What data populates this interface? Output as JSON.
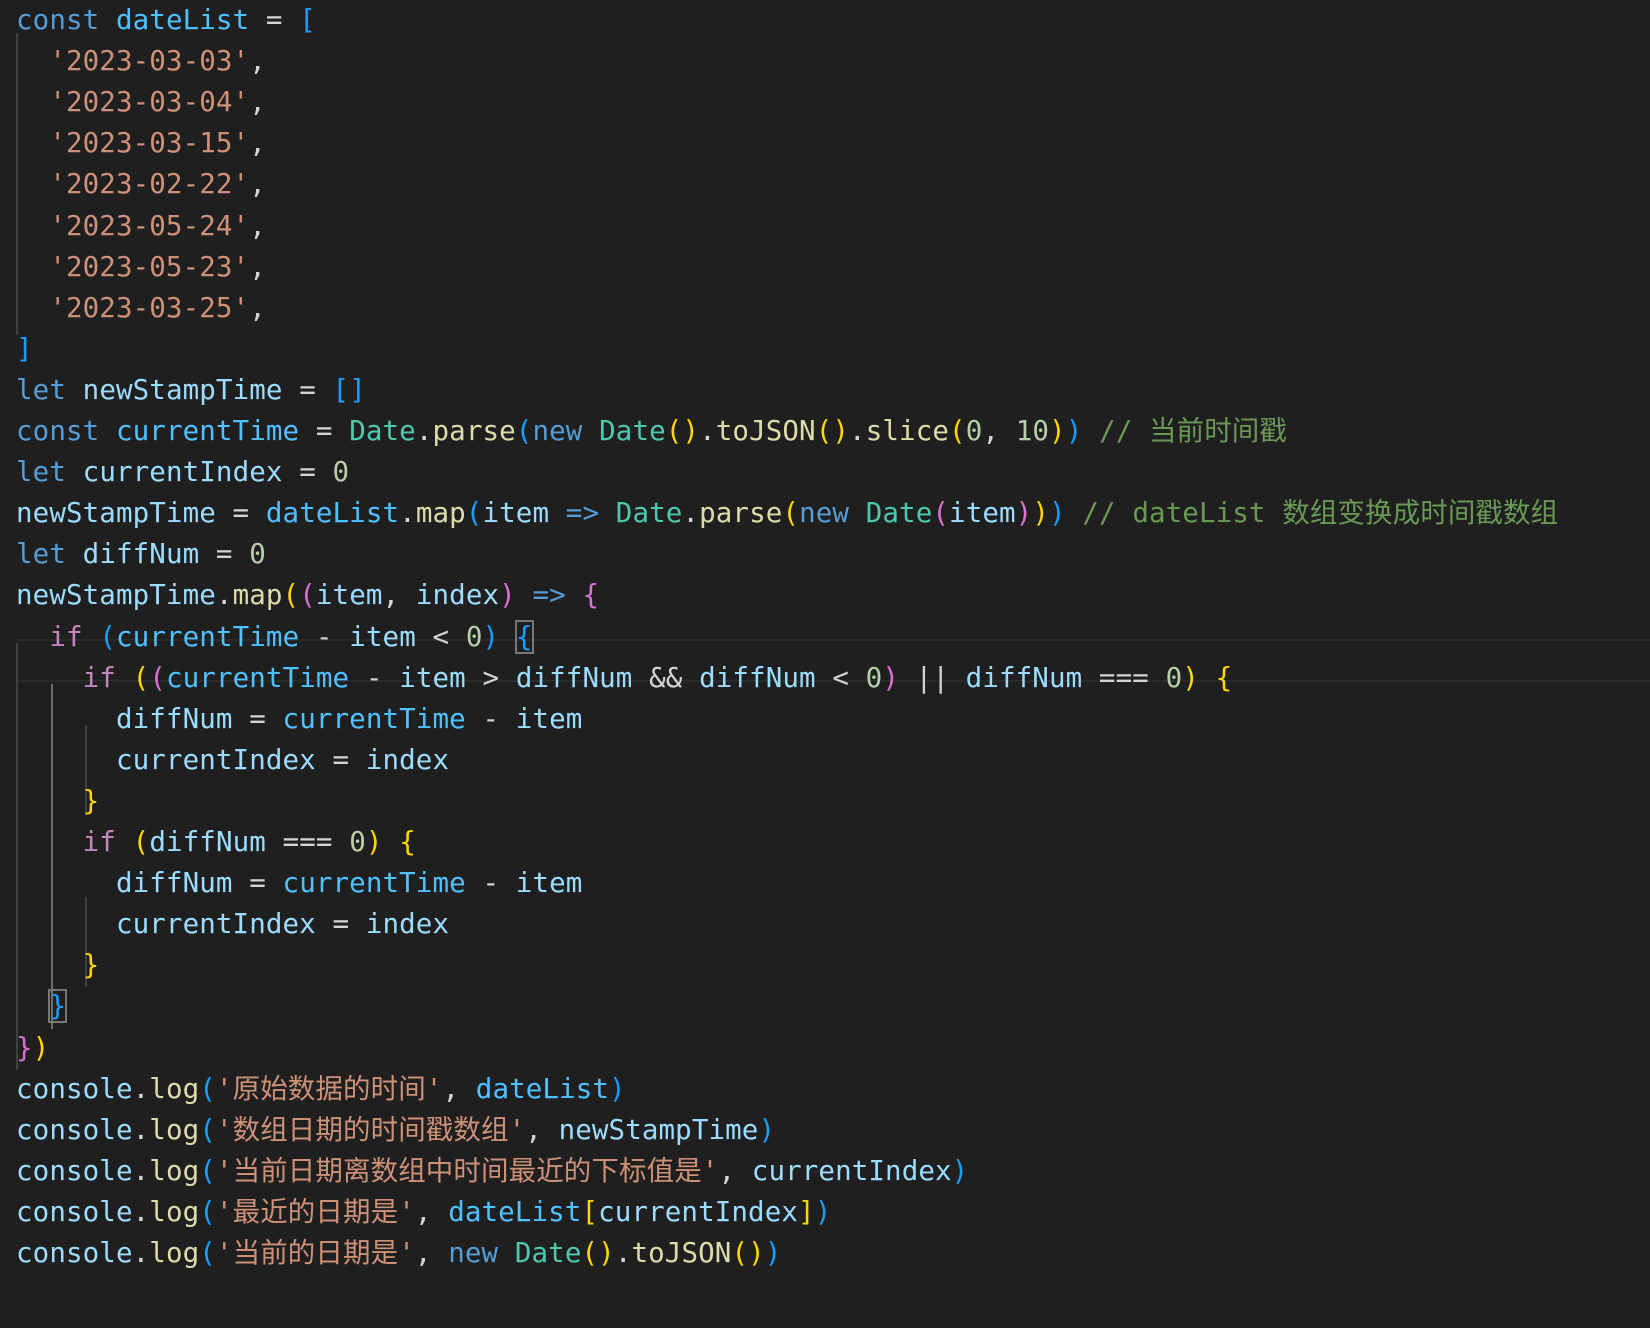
{
  "editor": {
    "language": "javascript",
    "theme": "dark",
    "font_size_px": 27.5,
    "current_line": 16,
    "lines": [
      [
        [
          "t-kw",
          "const"
        ],
        [
          "t-op",
          " "
        ],
        [
          "t-const",
          "dateList"
        ],
        [
          "t-op",
          " = "
        ],
        [
          "t-b3",
          "["
        ]
      ],
      [
        [
          "t-op",
          "  "
        ],
        [
          "t-str",
          "'2023-03-03'"
        ],
        [
          "t-op",
          ","
        ]
      ],
      [
        [
          "t-op",
          "  "
        ],
        [
          "t-str",
          "'2023-03-04'"
        ],
        [
          "t-op",
          ","
        ]
      ],
      [
        [
          "t-op",
          "  "
        ],
        [
          "t-str",
          "'2023-03-15'"
        ],
        [
          "t-op",
          ","
        ]
      ],
      [
        [
          "t-op",
          "  "
        ],
        [
          "t-str",
          "'2023-02-22'"
        ],
        [
          "t-op",
          ","
        ]
      ],
      [
        [
          "t-op",
          "  "
        ],
        [
          "t-str",
          "'2023-05-24'"
        ],
        [
          "t-op",
          ","
        ]
      ],
      [
        [
          "t-op",
          "  "
        ],
        [
          "t-str",
          "'2023-05-23'"
        ],
        [
          "t-op",
          ","
        ]
      ],
      [
        [
          "t-op",
          "  "
        ],
        [
          "t-str",
          "'2023-03-25'"
        ],
        [
          "t-op",
          ","
        ]
      ],
      [
        [
          "t-b3",
          "]"
        ]
      ],
      [
        [
          "t-kw",
          "let"
        ],
        [
          "t-op",
          " "
        ],
        [
          "t-var",
          "newStampTime"
        ],
        [
          "t-op",
          " = "
        ],
        [
          "t-b3",
          "[]"
        ]
      ],
      [
        [
          "t-kw",
          "const"
        ],
        [
          "t-op",
          " "
        ],
        [
          "t-const",
          "currentTime"
        ],
        [
          "t-op",
          " = "
        ],
        [
          "t-cls",
          "Date"
        ],
        [
          "t-op",
          "."
        ],
        [
          "t-fn",
          "parse"
        ],
        [
          "t-b3",
          "("
        ],
        [
          "t-kw",
          "new"
        ],
        [
          "t-op",
          " "
        ],
        [
          "t-cls",
          "Date"
        ],
        [
          "t-b1",
          "()"
        ],
        [
          "t-op",
          "."
        ],
        [
          "t-fn",
          "toJSON"
        ],
        [
          "t-b1",
          "()"
        ],
        [
          "t-op",
          "."
        ],
        [
          "t-fn",
          "slice"
        ],
        [
          "t-b1",
          "("
        ],
        [
          "t-num",
          "0"
        ],
        [
          "t-op",
          ", "
        ],
        [
          "t-num",
          "10"
        ],
        [
          "t-b1",
          ")"
        ],
        [
          "t-b3",
          ")"
        ],
        [
          "t-op",
          " "
        ],
        [
          "t-cmt",
          "// 当前时间戳"
        ]
      ],
      [
        [
          "t-kw",
          "let"
        ],
        [
          "t-op",
          " "
        ],
        [
          "t-var",
          "currentIndex"
        ],
        [
          "t-op",
          " = "
        ],
        [
          "t-num",
          "0"
        ]
      ],
      [
        [
          "t-var",
          "newStampTime"
        ],
        [
          "t-op",
          " = "
        ],
        [
          "t-const",
          "dateList"
        ],
        [
          "t-op",
          "."
        ],
        [
          "t-fn",
          "map"
        ],
        [
          "t-b3",
          "("
        ],
        [
          "t-var",
          "item"
        ],
        [
          "t-op",
          " "
        ],
        [
          "t-kw",
          "=>"
        ],
        [
          "t-op",
          " "
        ],
        [
          "t-cls",
          "Date"
        ],
        [
          "t-op",
          "."
        ],
        [
          "t-fn",
          "parse"
        ],
        [
          "t-b1",
          "("
        ],
        [
          "t-kw",
          "new"
        ],
        [
          "t-op",
          " "
        ],
        [
          "t-cls",
          "Date"
        ],
        [
          "t-b2",
          "("
        ],
        [
          "t-var",
          "item"
        ],
        [
          "t-b2",
          ")"
        ],
        [
          "t-b1",
          ")"
        ],
        [
          "t-b3",
          ")"
        ],
        [
          "t-op",
          " "
        ],
        [
          "t-cmt",
          "// dateList 数组变换成时间戳数组"
        ]
      ],
      [
        [
          "t-kw",
          "let"
        ],
        [
          "t-op",
          " "
        ],
        [
          "t-var",
          "diffNum"
        ],
        [
          "t-op",
          " = "
        ],
        [
          "t-num",
          "0"
        ]
      ],
      [
        [
          "t-var",
          "newStampTime"
        ],
        [
          "t-op",
          "."
        ],
        [
          "t-fn",
          "map"
        ],
        [
          "t-b1",
          "("
        ],
        [
          "t-b2",
          "("
        ],
        [
          "t-var",
          "item"
        ],
        [
          "t-op",
          ", "
        ],
        [
          "t-var",
          "index"
        ],
        [
          "t-b2",
          ")"
        ],
        [
          "t-op",
          " "
        ],
        [
          "t-kw",
          "=>"
        ],
        [
          "t-op",
          " "
        ],
        [
          "t-b2",
          "{"
        ]
      ],
      [
        [
          "t-op",
          "  "
        ],
        [
          "t-ctl",
          "if"
        ],
        [
          "t-op",
          " "
        ],
        [
          "t-b3",
          "("
        ],
        [
          "t-const",
          "currentTime"
        ],
        [
          "t-op",
          " - "
        ],
        [
          "t-var",
          "item"
        ],
        [
          "t-op",
          " < "
        ],
        [
          "t-num",
          "0"
        ],
        [
          "t-b3",
          ")"
        ],
        [
          "t-op",
          " "
        ],
        [
          "t-b3 bracket-match",
          "{"
        ]
      ],
      [
        [
          "t-op",
          "    "
        ],
        [
          "t-ctl",
          "if"
        ],
        [
          "t-op",
          " "
        ],
        [
          "t-b1",
          "("
        ],
        [
          "t-b2",
          "("
        ],
        [
          "t-const",
          "currentTime"
        ],
        [
          "t-op",
          " - "
        ],
        [
          "t-var",
          "item"
        ],
        [
          "t-op",
          " > "
        ],
        [
          "t-var",
          "diffNum"
        ],
        [
          "t-op",
          " && "
        ],
        [
          "t-var",
          "diffNum"
        ],
        [
          "t-op",
          " < "
        ],
        [
          "t-num",
          "0"
        ],
        [
          "t-b2",
          ")"
        ],
        [
          "t-op",
          " || "
        ],
        [
          "t-var",
          "diffNum"
        ],
        [
          "t-op",
          " === "
        ],
        [
          "t-num",
          "0"
        ],
        [
          "t-b1",
          ")"
        ],
        [
          "t-op",
          " "
        ],
        [
          "t-b1",
          "{"
        ]
      ],
      [
        [
          "t-op",
          "      "
        ],
        [
          "t-var",
          "diffNum"
        ],
        [
          "t-op",
          " = "
        ],
        [
          "t-const",
          "currentTime"
        ],
        [
          "t-op",
          " - "
        ],
        [
          "t-var",
          "item"
        ]
      ],
      [
        [
          "t-op",
          "      "
        ],
        [
          "t-var",
          "currentIndex"
        ],
        [
          "t-op",
          " = "
        ],
        [
          "t-var",
          "index"
        ]
      ],
      [
        [
          "t-op",
          "    "
        ],
        [
          "t-b1",
          "}"
        ]
      ],
      [
        [
          "t-op",
          "    "
        ],
        [
          "t-ctl",
          "if"
        ],
        [
          "t-op",
          " "
        ],
        [
          "t-b1",
          "("
        ],
        [
          "t-var",
          "diffNum"
        ],
        [
          "t-op",
          " === "
        ],
        [
          "t-num",
          "0"
        ],
        [
          "t-b1",
          ")"
        ],
        [
          "t-op",
          " "
        ],
        [
          "t-b1",
          "{"
        ]
      ],
      [
        [
          "t-op",
          "      "
        ],
        [
          "t-var",
          "diffNum"
        ],
        [
          "t-op",
          " = "
        ],
        [
          "t-const",
          "currentTime"
        ],
        [
          "t-op",
          " - "
        ],
        [
          "t-var",
          "item"
        ]
      ],
      [
        [
          "t-op",
          "      "
        ],
        [
          "t-var",
          "currentIndex"
        ],
        [
          "t-op",
          " = "
        ],
        [
          "t-var",
          "index"
        ]
      ],
      [
        [
          "t-op",
          "    "
        ],
        [
          "t-b1",
          "}"
        ]
      ],
      [
        [
          "t-op",
          "  "
        ],
        [
          "t-b3 bracket-match",
          "}"
        ]
      ],
      [
        [
          "t-b2",
          "}"
        ],
        [
          "t-b1",
          ")"
        ]
      ],
      [
        [
          "t-var",
          "console"
        ],
        [
          "t-op",
          "."
        ],
        [
          "t-fn",
          "log"
        ],
        [
          "t-b3",
          "("
        ],
        [
          "t-str",
          "'原始数据的时间'"
        ],
        [
          "t-op",
          ", "
        ],
        [
          "t-const",
          "dateList"
        ],
        [
          "t-b3",
          ")"
        ]
      ],
      [
        [
          "t-var",
          "console"
        ],
        [
          "t-op",
          "."
        ],
        [
          "t-fn",
          "log"
        ],
        [
          "t-b3",
          "("
        ],
        [
          "t-str",
          "'数组日期的时间戳数组'"
        ],
        [
          "t-op",
          ", "
        ],
        [
          "t-var",
          "newStampTime"
        ],
        [
          "t-b3",
          ")"
        ]
      ],
      [
        [
          "t-var",
          "console"
        ],
        [
          "t-op",
          "."
        ],
        [
          "t-fn",
          "log"
        ],
        [
          "t-b3",
          "("
        ],
        [
          "t-str",
          "'当前日期离数组中时间最近的下标值是'"
        ],
        [
          "t-op",
          ", "
        ],
        [
          "t-var",
          "currentIndex"
        ],
        [
          "t-b3",
          ")"
        ]
      ],
      [
        [
          "t-var",
          "console"
        ],
        [
          "t-op",
          "."
        ],
        [
          "t-fn",
          "log"
        ],
        [
          "t-b3",
          "("
        ],
        [
          "t-str",
          "'最近的日期是'"
        ],
        [
          "t-op",
          ", "
        ],
        [
          "t-const",
          "dateList"
        ],
        [
          "t-b1",
          "["
        ],
        [
          "t-var",
          "currentIndex"
        ],
        [
          "t-b1",
          "]"
        ],
        [
          "t-b3",
          ")"
        ]
      ],
      [
        [
          "t-var",
          "console"
        ],
        [
          "t-op",
          "."
        ],
        [
          "t-fn",
          "log"
        ],
        [
          "t-b3",
          "("
        ],
        [
          "t-str",
          "'当前的日期是'"
        ],
        [
          "t-op",
          ", "
        ],
        [
          "t-kw",
          "new"
        ],
        [
          "t-op",
          " "
        ],
        [
          "t-cls",
          "Date"
        ],
        [
          "t-b1",
          "()"
        ],
        [
          "t-op",
          "."
        ],
        [
          "t-fn",
          "toJSON"
        ],
        [
          "t-b1",
          "()"
        ],
        [
          "t-b3",
          ")"
        ]
      ]
    ]
  }
}
